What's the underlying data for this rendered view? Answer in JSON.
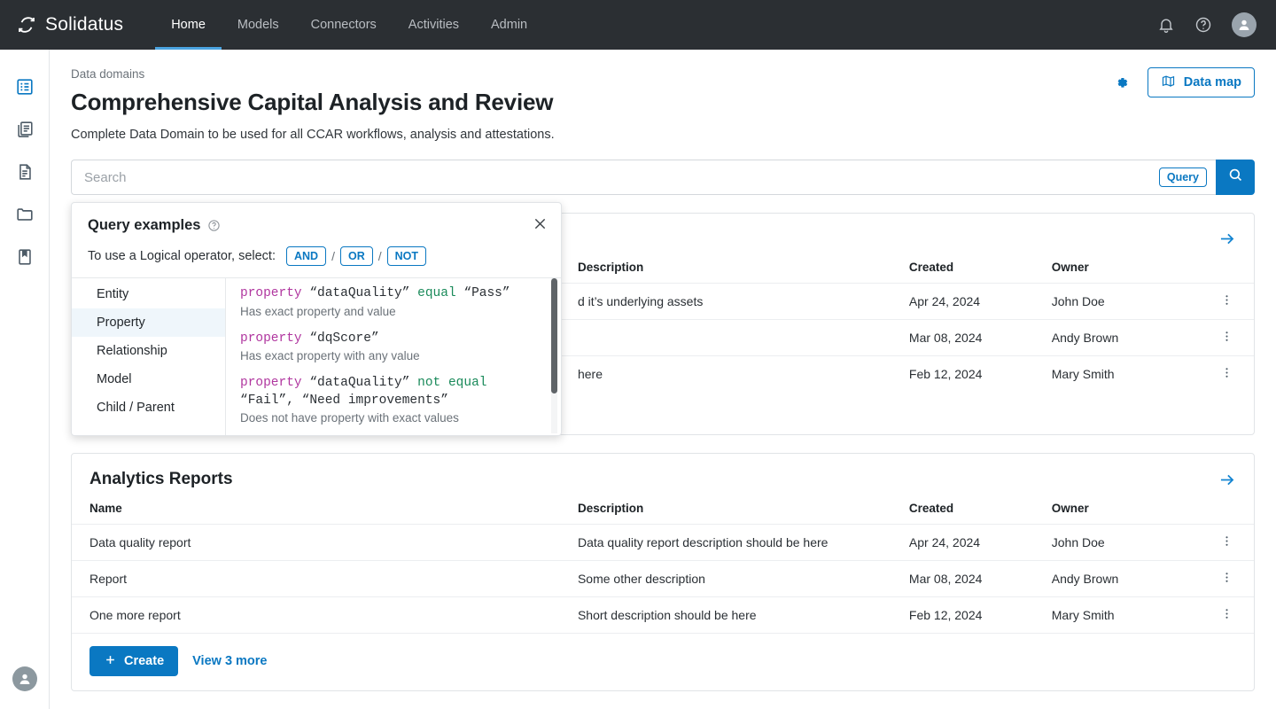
{
  "topnav": {
    "brand": "Solidatus",
    "brand_icon": "solidatus-logo-icon",
    "links": [
      {
        "label": "Home",
        "active": true
      },
      {
        "label": "Models",
        "active": false
      },
      {
        "label": "Connectors",
        "active": false
      },
      {
        "label": "Activities",
        "active": false
      },
      {
        "label": "Admin",
        "active": false
      }
    ],
    "icons": [
      "bell-icon",
      "help-circle-icon",
      "user-avatar-icon"
    ]
  },
  "sidebar": {
    "items": [
      {
        "name": "list-view-icon",
        "active": true
      },
      {
        "name": "documents-icon",
        "active": false
      },
      {
        "name": "document-icon",
        "active": false
      },
      {
        "name": "folder-icon",
        "active": false
      },
      {
        "name": "bookmark-icon",
        "active": false
      }
    ],
    "bottom_avatar": "user-avatar-icon"
  },
  "header": {
    "breadcrumb": "Data domains",
    "title": "Comprehensive Capital Analysis and Review",
    "subtitle": "Complete Data Domain to be used for all CCAR workflows, analysis and attestations.",
    "gear_icon": "gear-icon",
    "datamap_label": "Data map",
    "datamap_icon": "map-icon"
  },
  "search": {
    "placeholder": "Search",
    "value": "",
    "query_chip": "Query",
    "search_icon": "search-icon"
  },
  "query_popup": {
    "title": "Query examples",
    "help_icon": "help-circle-icon",
    "close_icon": "close-icon",
    "operator_label": "To use a Logical operator, select:",
    "operators": [
      "AND",
      "OR",
      "NOT"
    ],
    "separator": "/",
    "categories": [
      {
        "label": "Entity",
        "active": false
      },
      {
        "label": "Property",
        "active": true
      },
      {
        "label": "Relationship",
        "active": false
      },
      {
        "label": "Model",
        "active": false
      },
      {
        "label": "Child / Parent",
        "active": false
      }
    ],
    "examples": [
      {
        "kw": "property",
        "arg": "“dataQuality”",
        "op": "equal",
        "val": "“Pass”",
        "desc": "Has exact property and value"
      },
      {
        "kw": "property",
        "arg": "“dqScore”",
        "op": "",
        "val": "",
        "desc": "Has exact property with any value"
      },
      {
        "kw": "property",
        "arg": "“dataQuality”",
        "op": "not equal",
        "val": "“Fail”, “Need improvements”",
        "desc": "Does not have property with exact values"
      }
    ]
  },
  "cards": [
    {
      "title": "",
      "arrow_icon": "arrow-right-icon",
      "columns": [
        "Name",
        "Description",
        "Created",
        "Owner"
      ],
      "rows": [
        {
          "name": "",
          "description": "d it’s underlying assets",
          "created": "Apr 24, 2024",
          "owner": "John Doe",
          "menu_icon": "kebab-menu-icon"
        },
        {
          "name": "",
          "description": "",
          "created": "Mar 08, 2024",
          "owner": "Andy Brown",
          "menu_icon": "kebab-menu-icon"
        },
        {
          "name": "",
          "description": "here",
          "created": "Feb 12, 2024",
          "owner": "Mary Smith",
          "menu_icon": "kebab-menu-icon"
        }
      ]
    },
    {
      "title": "Analytics Reports",
      "arrow_icon": "arrow-right-icon",
      "columns": [
        "Name",
        "Description",
        "Created",
        "Owner"
      ],
      "rows": [
        {
          "name": "Data quality report",
          "description": "Data quality report description should be here",
          "created": "Apr 24, 2024",
          "owner": "John Doe",
          "menu_icon": "kebab-menu-icon"
        },
        {
          "name": "Report",
          "description": "Some other description",
          "created": "Mar 08, 2024",
          "owner": "Andy Brown",
          "menu_icon": "kebab-menu-icon"
        },
        {
          "name": "One more report",
          "description": "Short description should be here",
          "created": "Feb 12, 2024",
          "owner": "Mary Smith",
          "menu_icon": "kebab-menu-icon"
        }
      ],
      "create_label": "Create",
      "create_icon": "plus-icon",
      "view_more_label": "View 3 more"
    }
  ],
  "colors": {
    "accent": "#0a78c2",
    "nav_bg": "#2b2f33",
    "nav_active_underline": "#4aa3df",
    "keyword": "#b0369f",
    "operator": "#1a8a5a",
    "selected_row_bg": "#eff6fb"
  }
}
